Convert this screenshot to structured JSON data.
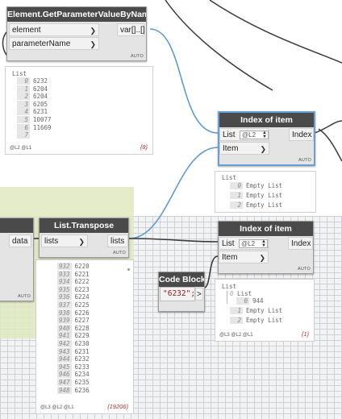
{
  "nodes": {
    "get_param": {
      "title": "Element.GetParameterValueByName",
      "input_element": "element",
      "input_parameter": "parameterName",
      "output": "var[]..[]",
      "auto": "AUTO",
      "preview": {
        "header": "List",
        "rows": [
          {
            "i": "0",
            "v": "6232"
          },
          {
            "i": "1",
            "v": "6204"
          },
          {
            "i": "2",
            "v": "6204"
          },
          {
            "i": "3",
            "v": "6205"
          },
          {
            "i": "4",
            "v": "6231"
          },
          {
            "i": "5",
            "v": "10077"
          },
          {
            "i": "6",
            "v": "11669"
          },
          {
            "i": "7",
            "v": ""
          }
        ],
        "levels": "@L2 @L1",
        "count": "{8}"
      }
    },
    "index_of_item_1": {
      "title": "Index of item",
      "input_list": "List",
      "input_item": "Item",
      "output": "Index",
      "lacing": "@L2",
      "auto": "AUTO",
      "preview": {
        "header": "List",
        "rows": [
          {
            "i": "0",
            "v": "Empty List"
          },
          {
            "i": "1",
            "v": "Empty List"
          },
          {
            "i": "2",
            "v": "Empty List"
          }
        ]
      }
    },
    "list_transpose": {
      "title": "List.Transpose",
      "input": "lists",
      "output": "lists",
      "auto": "AUTO",
      "preview": {
        "rows": [
          {
            "i": "932",
            "v": "6220"
          },
          {
            "i": "933",
            "v": "6221"
          },
          {
            "i": "934",
            "v": "6222"
          },
          {
            "i": "935",
            "v": "6223"
          },
          {
            "i": "936",
            "v": "6224"
          },
          {
            "i": "937",
            "v": "6225"
          },
          {
            "i": "938",
            "v": "6226"
          },
          {
            "i": "939",
            "v": "6227"
          },
          {
            "i": "940",
            "v": "6228"
          },
          {
            "i": "941",
            "v": "6229"
          },
          {
            "i": "942",
            "v": "6230"
          },
          {
            "i": "943",
            "v": "6231"
          },
          {
            "i": "944",
            "v": "6232"
          },
          {
            "i": "945",
            "v": "6233"
          },
          {
            "i": "946",
            "v": "6234"
          },
          {
            "i": "947",
            "v": "6235"
          },
          {
            "i": "948",
            "v": "6236"
          }
        ],
        "levels": "@L3 @L2 @L1",
        "count": "{19206}"
      }
    },
    "left_partial": {
      "output": "data",
      "auto": "AUTO"
    },
    "code_block": {
      "title": "Code Block",
      "code": "\"6232\";",
      "output": ">"
    },
    "index_of_item_2": {
      "title": "Index of item",
      "input_list": "List",
      "input_item": "Item",
      "output": "Index",
      "lacing": "@L2",
      "auto": "AUTO",
      "preview": {
        "header": "List",
        "sub_header": "List",
        "rows": [
          {
            "i": "0",
            "v": "944",
            "nested": true
          },
          {
            "i": "1",
            "v": "Empty List"
          },
          {
            "i": "2",
            "v": "Empty List"
          }
        ],
        "levels": "@L3 @L2 @L1",
        "count": "{1}"
      }
    }
  },
  "colors": {
    "node_header": "#4a4a4a",
    "wire": "#5b9bd5",
    "wire_dark": "#3a3a3a",
    "group_fill": "#dfe9bf",
    "selection": "#6a9fd6"
  }
}
